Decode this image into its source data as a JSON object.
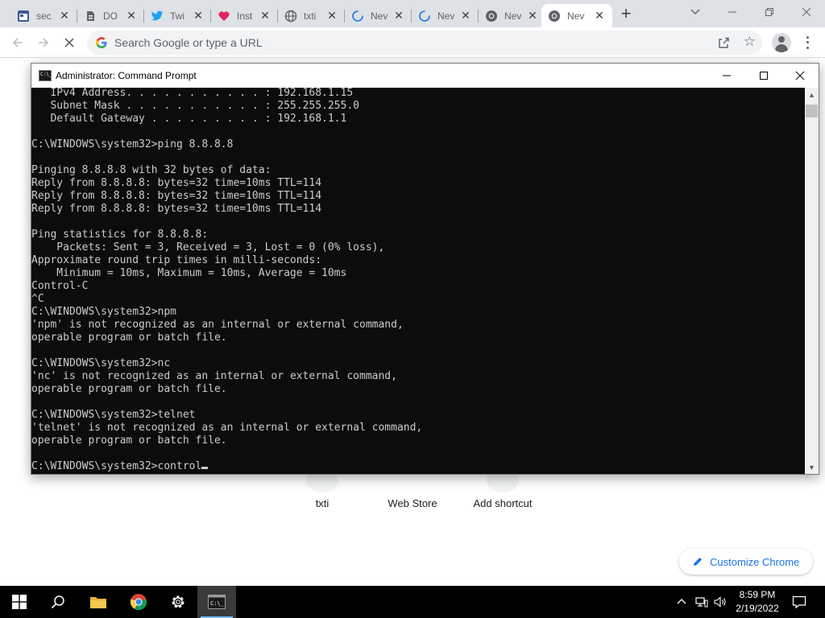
{
  "browser": {
    "tabs": [
      {
        "label": "sec",
        "favicon": "calendar-icon",
        "active": false
      },
      {
        "label": "DO",
        "favicon": "doc-icon",
        "active": false
      },
      {
        "label": "Twi",
        "favicon": "twitter-icon",
        "active": false
      },
      {
        "label": "Inst",
        "favicon": "heart-icon",
        "active": false
      },
      {
        "label": "txti",
        "favicon": "globe-icon",
        "active": false
      },
      {
        "label": "Nev",
        "favicon": "loading-icon",
        "active": false
      },
      {
        "label": "Nev",
        "favicon": "loading-icon",
        "active": false
      },
      {
        "label": "Nev",
        "favicon": "chrome-icon",
        "active": false
      },
      {
        "label": "Nev",
        "favicon": "chrome-icon",
        "active": true
      }
    ],
    "omnibox_placeholder": "Search Google or type a URL",
    "accent": "#1a73e8"
  },
  "newtab": {
    "shortcuts": [
      "txti",
      "Web Store",
      "Add shortcut"
    ],
    "customize_label": "Customize Chrome"
  },
  "cmd": {
    "title": "Administrator: Command Prompt",
    "lines": [
      "   IPv4 Address. . . . . . . . . . . : 192.168.1.15",
      "   Subnet Mask . . . . . . . . . . . : 255.255.255.0",
      "   Default Gateway . . . . . . . . . : 192.168.1.1",
      "",
      "C:\\WINDOWS\\system32>ping 8.8.8.8",
      "",
      "Pinging 8.8.8.8 with 32 bytes of data:",
      "Reply from 8.8.8.8: bytes=32 time=10ms TTL=114",
      "Reply from 8.8.8.8: bytes=32 time=10ms TTL=114",
      "Reply from 8.8.8.8: bytes=32 time=10ms TTL=114",
      "",
      "Ping statistics for 8.8.8.8:",
      "    Packets: Sent = 3, Received = 3, Lost = 0 (0% loss),",
      "Approximate round trip times in milli-seconds:",
      "    Minimum = 10ms, Maximum = 10ms, Average = 10ms",
      "Control-C",
      "^C",
      "C:\\WINDOWS\\system32>npm",
      "'npm' is not recognized as an internal or external command,",
      "operable program or batch file.",
      "",
      "C:\\WINDOWS\\system32>nc",
      "'nc' is not recognized as an internal or external command,",
      "operable program or batch file.",
      "",
      "C:\\WINDOWS\\system32>telnet",
      "'telnet' is not recognized as an internal or external command,",
      "operable program or batch file.",
      "",
      "C:\\WINDOWS\\system32>control"
    ],
    "background": "#0c0c0c",
    "foreground": "#cccccc"
  },
  "taskbar": {
    "time": "8:59 PM",
    "date": "2/19/2022",
    "apps": [
      "windows-start-icon",
      "search-icon",
      "file-explorer-icon",
      "chrome-icon",
      "settings-gear-icon",
      "command-prompt-icon"
    ]
  }
}
